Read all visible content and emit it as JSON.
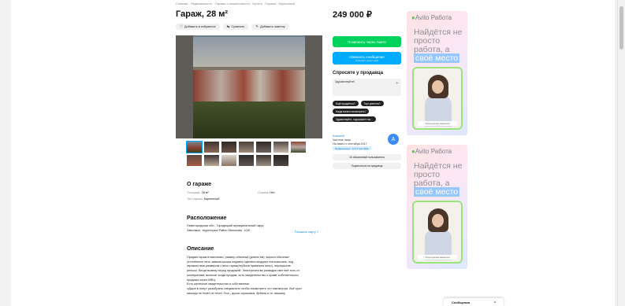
{
  "breadcrumb": "Главная · Недвижимость · Гаражи и машиноместа · Купить · Гаражи · Кирпичный",
  "listing": {
    "title": "Гараж, 28 м²",
    "actions": [
      {
        "icon": "heart-icon",
        "glyph": "♡",
        "label": "Добавить в избранное"
      },
      {
        "icon": "compare-icon",
        "glyph": "⇆",
        "label": "Сравнить"
      },
      {
        "icon": "note-icon",
        "glyph": "✎",
        "label": "Добавить заметку"
      }
    ],
    "thumbnail_count": 13
  },
  "about": {
    "heading": "О гараже",
    "area_label": "Площадь:",
    "area_value": "28 м²",
    "guard_label": "Охрана:",
    "guard_value": "Нет",
    "type_label": "Тип гаража:",
    "type_value": "Кирпичный"
  },
  "location": {
    "heading": "Расположение",
    "address_line1": "Нижегородская обл., Городецкий муниципальный округ,",
    "address_line2": "Заволжье, территория Район Малохово, 10/8",
    "show_map": "Показать карту"
  },
  "description": {
    "heading": "Описание",
    "lines": [
      "Продаю гараж в малохово, размер обычный (длина 6м), ворота обычные",
      "утеплённые пять замков,крыша недавно сделана модным техноиколем, под",
      "гаражом яма,размером с весь гараж(глубина примерно метр), перекрытие",
      "рельсы. Вещи вывезу перед продажей. Электричество разводка свет всё есть от",
      "кооператива, включат когда продам, есть свидетельство о праве собственности",
      "продажа через МФЦ.",
      "Есть железное свидетельство и собственник.",
      "«Дыра в полу» разобрана специально чтобы посмотреть что там внутри. Всё сухо",
      "никогда не гниёт не течет. Пол - доски сороковка, брёвна и тп, машину"
    ]
  },
  "sidebar": {
    "price": "249 000 ₽",
    "call_button": "Позвонить через Авито",
    "message_button": "Написать сообщение",
    "message_sub": "Отвечает около часа",
    "ask_heading": "Спросите у продавца",
    "ask_value": "Здравствуйте!",
    "quick_questions": [
      "Ещё продаётся?",
      "Торг уместен?",
      "Когда можно посмотреть?",
      "Здравствуйте, подскажите пж..."
    ],
    "seller_name": "Алексей",
    "seller_type": "Частное лицо",
    "seller_since": "На Авито с сентября 2017",
    "verified": "Проверенные · 12 17 ноя 2021",
    "avatar_letter": "А",
    "listings_button": "16 объявлений пользователя",
    "subscribe_button": "Подписаться на продавца"
  },
  "ads": [
    {
      "brand": "Avito Работа",
      "slogan_main": "Найдётся не просто работа, а",
      "slogan_highlight": "своё место",
      "caption": "Подходящая вакансия"
    },
    {
      "brand": "Avito Работа",
      "slogan_main": "Найдётся не просто работа, а",
      "slogan_highlight": "своё место",
      "caption": "Подходящая вакансия"
    }
  ],
  "messages_bar": {
    "label": "Сообщения",
    "toggle": "^"
  }
}
